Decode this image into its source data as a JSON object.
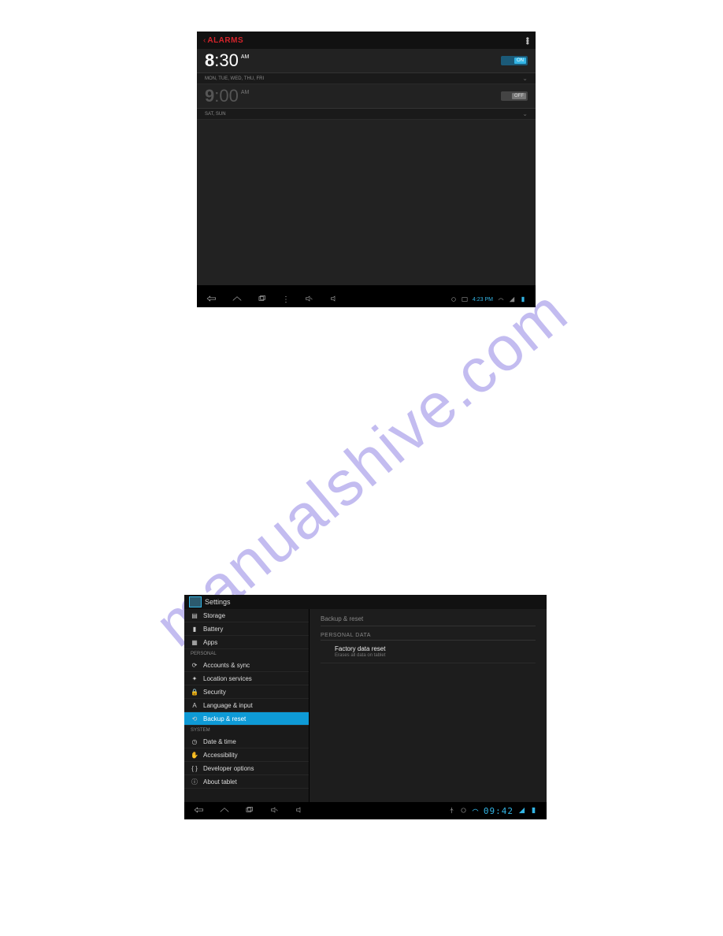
{
  "watermark": "manualshive.com",
  "alarms": {
    "title": "ALARMS",
    "list": [
      {
        "hour": "8",
        "minute": ":30",
        "ampm": "AM",
        "switch_label": "ON",
        "on": true,
        "days": "MON, TUE, WED, THU, FRI"
      },
      {
        "hour": "9",
        "minute": ":00",
        "ampm": "AM",
        "switch_label": "OFF",
        "on": false,
        "days": "SAT, SUN"
      }
    ],
    "status_time": "4:23 PM"
  },
  "settings": {
    "title": "Settings",
    "sidebar": {
      "top_items": [
        {
          "icon": "storage",
          "label": "Storage"
        },
        {
          "icon": "battery",
          "label": "Battery"
        },
        {
          "icon": "apps",
          "label": "Apps"
        }
      ],
      "sections": [
        {
          "label": "PERSONAL",
          "items": [
            {
              "icon": "sync",
              "label": "Accounts & sync"
            },
            {
              "icon": "location",
              "label": "Location services"
            },
            {
              "icon": "lock",
              "label": "Security"
            },
            {
              "icon": "language",
              "label": "Language & input"
            },
            {
              "icon": "reset",
              "label": "Backup & reset",
              "active": true
            }
          ]
        },
        {
          "label": "SYSTEM",
          "items": [
            {
              "icon": "clock",
              "label": "Date & time"
            },
            {
              "icon": "hand",
              "label": "Accessibility"
            },
            {
              "icon": "dev",
              "label": "Developer options"
            },
            {
              "icon": "info",
              "label": "About tablet"
            }
          ]
        }
      ]
    },
    "main": {
      "title": "Backup & reset",
      "subheader": "PERSONAL DATA",
      "entry_title": "Factory data reset",
      "entry_sub": "Erases all data on tablet"
    },
    "status_time": "09:42"
  }
}
